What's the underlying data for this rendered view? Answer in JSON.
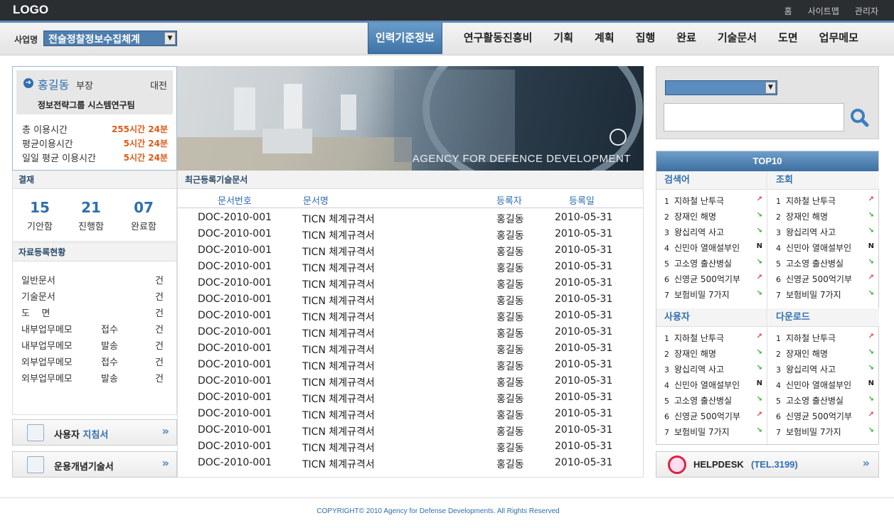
{
  "topbar": {
    "logo": "LOGO",
    "links": [
      "홈",
      "사이트맵",
      "관리자"
    ]
  },
  "nav": {
    "biz_label": "사업명",
    "biz_value": "전술정찰정보수집체계",
    "menu": [
      "인력기준정보",
      "연구활동진흥비",
      "기획",
      "계획",
      "집행",
      "완료",
      "기술문서",
      "도면",
      "업무메모"
    ],
    "active_index": 0
  },
  "profile": {
    "name": "홍길동",
    "title": "부장",
    "region": "대전",
    "dept": "정보전략그룹  시스템연구팀",
    "stats": [
      {
        "label": "총 이용시간",
        "value": "255시간 24분"
      },
      {
        "label": "평균이용시간",
        "value": "5시간 24분"
      },
      {
        "label": "일일 평균 이용시간",
        "value": "5시간 24분"
      }
    ]
  },
  "approval": {
    "title": "결재",
    "items": [
      {
        "num": "15",
        "label": "기안함"
      },
      {
        "num": "21",
        "label": "진행함"
      },
      {
        "num": "07",
        "label": "완료함"
      }
    ]
  },
  "docs": {
    "title": "자료등록현황",
    "rows": [
      {
        "label": "일반문서",
        "sub": "",
        "unit": "건"
      },
      {
        "label": "기술문서",
        "sub": "",
        "unit": "건"
      },
      {
        "label": "도    면",
        "sub": "",
        "unit": "건"
      },
      {
        "label": "내부업무메모",
        "sub": "접수",
        "unit": "건"
      },
      {
        "label": "내부업무메모",
        "sub": "발송",
        "unit": "건"
      },
      {
        "label": "외부업무메모",
        "sub": "접수",
        "unit": "건"
      },
      {
        "label": "외부업무메모",
        "sub": "발송",
        "unit": "건"
      }
    ]
  },
  "side_buttons": [
    {
      "label": "사용자",
      "label_accent": "지침서",
      "icon": "document-list-icon"
    },
    {
      "label": "운용개념기술서",
      "label_accent": "",
      "icon": "checklist-icon"
    }
  ],
  "banner": {
    "text": "AGENCY FOR DEFENCE DEVELOPMENT"
  },
  "recent": {
    "title": "최근등록기술문서",
    "columns": [
      "문서번호",
      "문서명",
      "등록자",
      "등록일"
    ],
    "rows": [
      [
        "DOC-2010-001",
        "TICN 체계규격서",
        "홍길동",
        "2010-05-31"
      ],
      [
        "DOC-2010-001",
        "TICN 체계규격서",
        "홍길동",
        "2010-05-31"
      ],
      [
        "DOC-2010-001",
        "TICN 체계규격서",
        "홍길동",
        "2010-05-31"
      ],
      [
        "DOC-2010-001",
        "TICN 체계규격서",
        "홍길동",
        "2010-05-31"
      ],
      [
        "DOC-2010-001",
        "TICN 체계규격서",
        "홍길동",
        "2010-05-31"
      ],
      [
        "DOC-2010-001",
        "TICN 체계규격서",
        "홍길동",
        "2010-05-31"
      ],
      [
        "DOC-2010-001",
        "TICN 체계규격서",
        "홍길동",
        "2010-05-31"
      ],
      [
        "DOC-2010-001",
        "TICN 체계규격서",
        "홍길동",
        "2010-05-31"
      ],
      [
        "DOC-2010-001",
        "TICN 체계규격서",
        "홍길동",
        "2010-05-31"
      ],
      [
        "DOC-2010-001",
        "TICN 체계규격서",
        "홍길동",
        "2010-05-31"
      ],
      [
        "DOC-2010-001",
        "TICN 체계규격서",
        "홍길동",
        "2010-05-31"
      ],
      [
        "DOC-2010-001",
        "TICN 체계규격서",
        "홍길동",
        "2010-05-31"
      ],
      [
        "DOC-2010-001",
        "TICN 체계규격서",
        "홍길동",
        "2010-05-31"
      ],
      [
        "DOC-2010-001",
        "TICN 체계규격서",
        "홍길동",
        "2010-05-31"
      ],
      [
        "DOC-2010-001",
        "TICN 체계규격서",
        "홍길동",
        "2010-05-31"
      ],
      [
        "DOC-2010-001",
        "TICN 체계규격서",
        "홍길동",
        "2010-05-31"
      ]
    ]
  },
  "search": {
    "select_value": "",
    "input_value": ""
  },
  "top10": {
    "title": "TOP10",
    "panels": [
      {
        "title": "검색어",
        "items": [
          {
            "rank": "1",
            "text": "지하철 난투극",
            "trend": "up"
          },
          {
            "rank": "2",
            "text": "장재인 해명",
            "trend": "down"
          },
          {
            "rank": "3",
            "text": "왕십리역 사고",
            "trend": "down"
          },
          {
            "rank": "4",
            "text": "신민아 열애설부인",
            "trend": "new"
          },
          {
            "rank": "5",
            "text": "고소영 출산병실",
            "trend": "down"
          },
          {
            "rank": "6",
            "text": "신영균 500억기부",
            "trend": "up"
          },
          {
            "rank": "7",
            "text": "보험비밀 7가지",
            "trend": "down"
          }
        ]
      },
      {
        "title": "조회",
        "items": [
          {
            "rank": "1",
            "text": "지하철 난투극",
            "trend": "up"
          },
          {
            "rank": "2",
            "text": "장재인 해명",
            "trend": "down"
          },
          {
            "rank": "3",
            "text": "왕십리역 사고",
            "trend": "down"
          },
          {
            "rank": "4",
            "text": "신민아 열애설부인",
            "trend": "new"
          },
          {
            "rank": "5",
            "text": "고소영 출산병실",
            "trend": "down"
          },
          {
            "rank": "6",
            "text": "신영균 500억기부",
            "trend": "up"
          },
          {
            "rank": "7",
            "text": "보험비밀 7가지",
            "trend": "down"
          }
        ]
      },
      {
        "title": "사용자",
        "items": [
          {
            "rank": "1",
            "text": "지하철 난투극",
            "trend": "up"
          },
          {
            "rank": "2",
            "text": "장재인 해명",
            "trend": "down"
          },
          {
            "rank": "3",
            "text": "왕십리역 사고",
            "trend": "down"
          },
          {
            "rank": "4",
            "text": "신민아 열애설부인",
            "trend": "new"
          },
          {
            "rank": "5",
            "text": "고소영 출산병실",
            "trend": "down"
          },
          {
            "rank": "6",
            "text": "신영균 500억기부",
            "trend": "up"
          },
          {
            "rank": "7",
            "text": "보험비밀 7가지",
            "trend": "down"
          }
        ]
      },
      {
        "title": "다운로드",
        "items": [
          {
            "rank": "1",
            "text": "지하철 난투극",
            "trend": "up"
          },
          {
            "rank": "2",
            "text": "장재인 해명",
            "trend": "down"
          },
          {
            "rank": "3",
            "text": "왕십리역 사고",
            "trend": "down"
          },
          {
            "rank": "4",
            "text": "신민아 열애설부인",
            "trend": "new"
          },
          {
            "rank": "5",
            "text": "고소영 출산병실",
            "trend": "down"
          },
          {
            "rank": "6",
            "text": "신영균 500억기부",
            "trend": "up"
          },
          {
            "rank": "7",
            "text": "보험비밀 7가지",
            "trend": "down"
          }
        ]
      }
    ],
    "trend_glyphs": {
      "up": "↗",
      "down": "↘",
      "new": "N"
    }
  },
  "helpdesk": {
    "label": "HELPDESK",
    "tel": "(TEL.3199)"
  },
  "footer": {
    "copyright": "COPYRIGHT© 2010 Agency for Defense Developments. All Rights Reserved"
  },
  "colors": {
    "accent": "#2f6fb0",
    "topbar": "#2b2e31",
    "stat_value": "#e05a16"
  }
}
